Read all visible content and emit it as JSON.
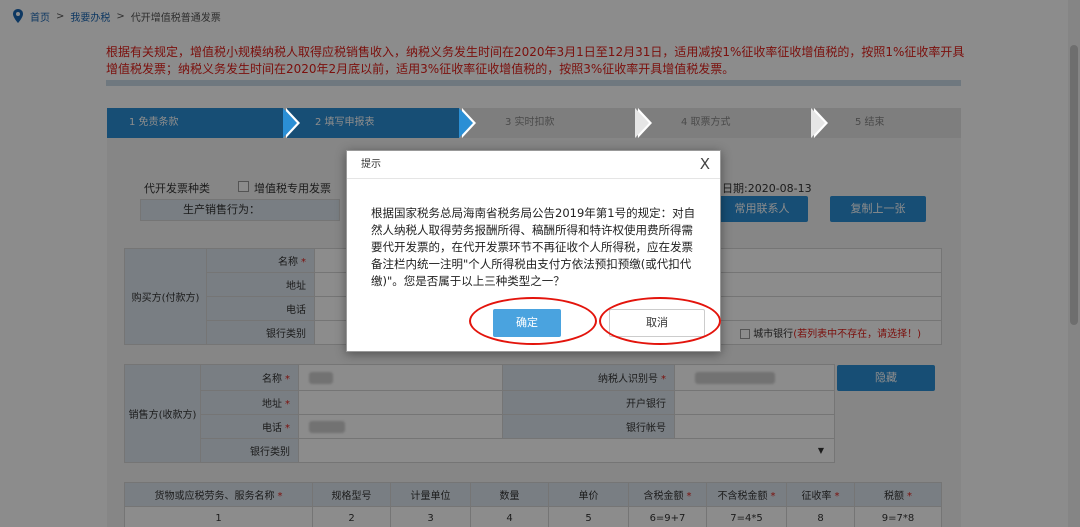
{
  "breadcrumb": {
    "home": "首页",
    "sep": ">",
    "section": "我要办税",
    "current": "代开增值税普通发票"
  },
  "notice": "根据有关规定，增值税小规模纳税人取得应税销售收入，纳税义务发生时间在2020年3月1日至12月31日，适用减按1%征收率征收增值税的，按照1%征收率开具增值税发票；纳税义务发生时间在2020年2月底以前，适用3%征收率征收增值税的，按照3%征收率开具增值税发票。",
  "steps": [
    "1 免责条款",
    "2 填写申报表",
    "3 实时扣款",
    "4 取票方式",
    "5 结束"
  ],
  "form": {
    "invoice_type_label": "代开发票种类",
    "vat_special_label": "增值税专用发票",
    "date_label": "日期:2020-08-13",
    "behavior_label": "生产销售行为：",
    "common_contact_btn": "常用联系人",
    "copy_prev_btn": "复制上一张",
    "buyer": {
      "group": "购买方(付款方)",
      "rows": [
        "名称",
        "地址",
        "电话",
        "银行类别"
      ],
      "city_bank": "城市银行",
      "city_bank_note": "(若列表中不存在，请选择！)"
    },
    "seller": {
      "group": "销售方(收款方)",
      "name": "名称",
      "address": "地址",
      "phone": "电话",
      "bank_type": "银行类别",
      "taxpayer_id": "纳税人识别号",
      "open_bank": "开户银行",
      "bank_account": "银行帐号",
      "hide_btn": "隐藏"
    },
    "goods_table": {
      "headers": [
        "货物或应税劳务、服务名称",
        "规格型号",
        "计量单位",
        "数量",
        "单价",
        "含税金额",
        "不含税金额",
        "征收率",
        "税额"
      ],
      "indices": [
        "1",
        "2",
        "3",
        "4",
        "5",
        "6=9+7",
        "7=4*5",
        "8",
        "9=7*8"
      ]
    }
  },
  "dialog": {
    "title": "提示",
    "close": "X",
    "body": "根据国家税务总局海南省税务局公告2019年第1号的规定：对自然人纳税人取得劳务报酬所得、稿酬所得和特许权使用费所得需要代开发票的，在代开发票环节不再征收个人所得税，应在发票备注栏内统一注明\"个人所得税由支付方依法预扣预缴(或代扣代缴)\"。您是否属于以上三种类型之一？",
    "ok": "确定",
    "cancel": "取消"
  },
  "colors": {
    "accent": "#2b8fd5",
    "alert_red": "#e0201a"
  }
}
